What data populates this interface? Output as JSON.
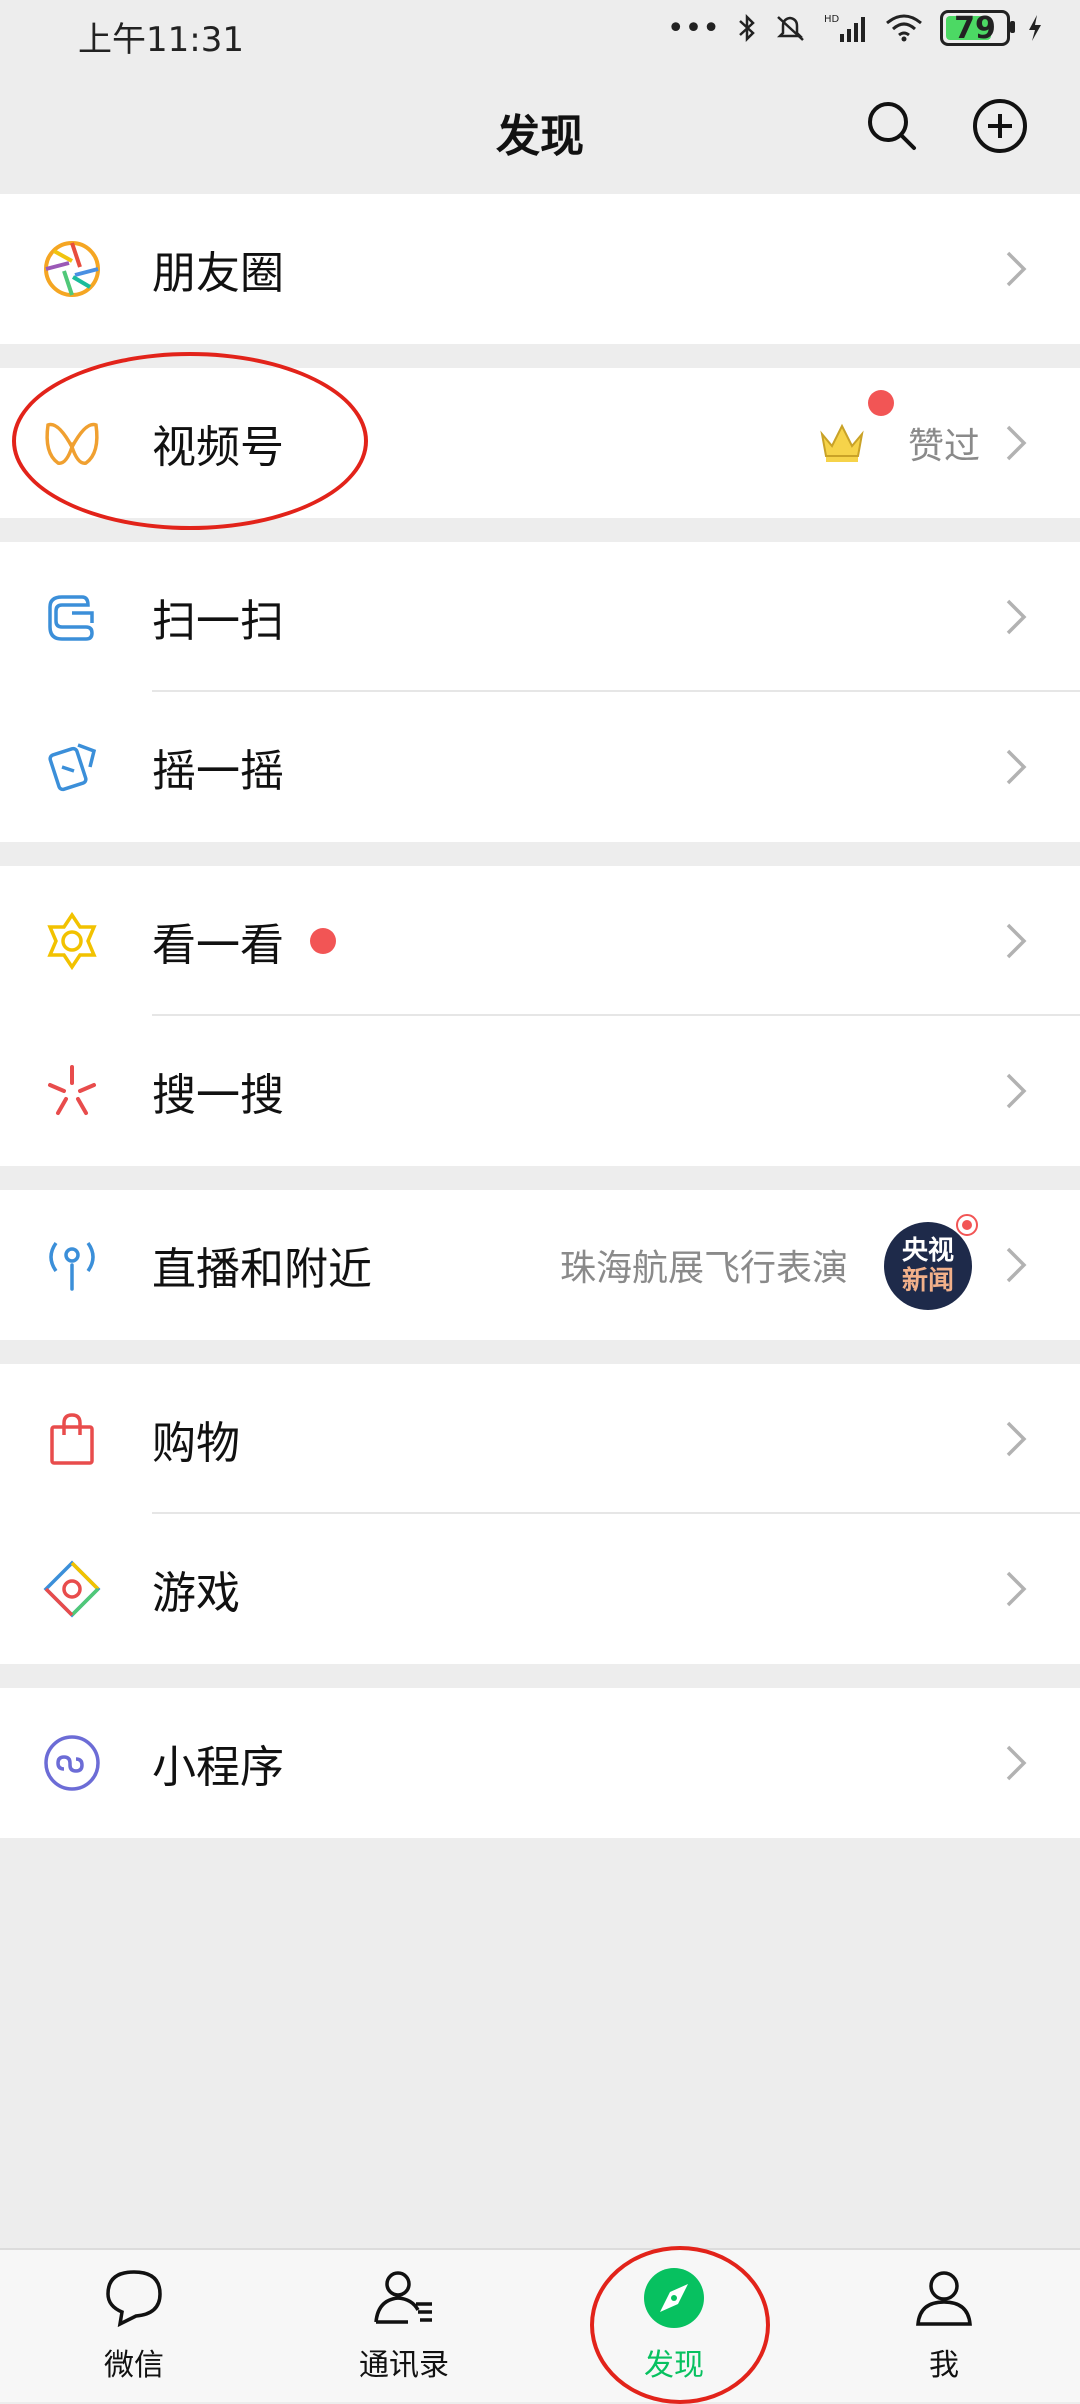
{
  "status_bar": {
    "time": "上午11:31",
    "battery": "79",
    "battery_level_percent": 79,
    "icons": [
      "more-dots-icon",
      "bluetooth-icon",
      "mute-icon",
      "hd-signal-icon",
      "wifi-icon",
      "battery-icon",
      "charging-icon"
    ]
  },
  "header": {
    "title": "发现",
    "actions": [
      "search-icon",
      "plus-circle-icon"
    ]
  },
  "menu": {
    "moments": {
      "label": "朋友圈",
      "icon": "moments-icon"
    },
    "channels": {
      "label": "视频号",
      "icon": "channels-icon",
      "extra_text": "赞过",
      "has_red_dot": true,
      "badge_icon": "crown-icon"
    },
    "scan": {
      "label": "扫一扫",
      "icon": "scan-icon"
    },
    "shake": {
      "label": "摇一摇",
      "icon": "shake-icon"
    },
    "top_stories": {
      "label": "看一看",
      "icon": "top-stories-icon",
      "has_red_dot": true
    },
    "search": {
      "label": "搜一搜",
      "icon": "search-spark-icon"
    },
    "live_nearby": {
      "label": "直播和附近",
      "icon": "live-nearby-icon",
      "extra_text": "珠海航展飞行表演",
      "avatar_text_top": "央视",
      "avatar_text_bottom": "新闻"
    },
    "shopping": {
      "label": "购物",
      "icon": "shopping-bag-icon"
    },
    "games": {
      "label": "游戏",
      "icon": "games-icon"
    },
    "mini_programs": {
      "label": "小程序",
      "icon": "mini-program-icon"
    }
  },
  "tabbar": {
    "tabs": [
      {
        "label": "微信",
        "icon": "chat-icon",
        "active": false
      },
      {
        "label": "通讯录",
        "icon": "contacts-icon",
        "active": false
      },
      {
        "label": "发现",
        "icon": "discover-compass-icon",
        "active": true
      },
      {
        "label": "我",
        "icon": "me-icon",
        "active": false
      }
    ]
  },
  "colors": {
    "background": "#ededed",
    "accent_green": "#07c160",
    "red_dot": "#f25555",
    "annotation_red": "#e2231a"
  }
}
